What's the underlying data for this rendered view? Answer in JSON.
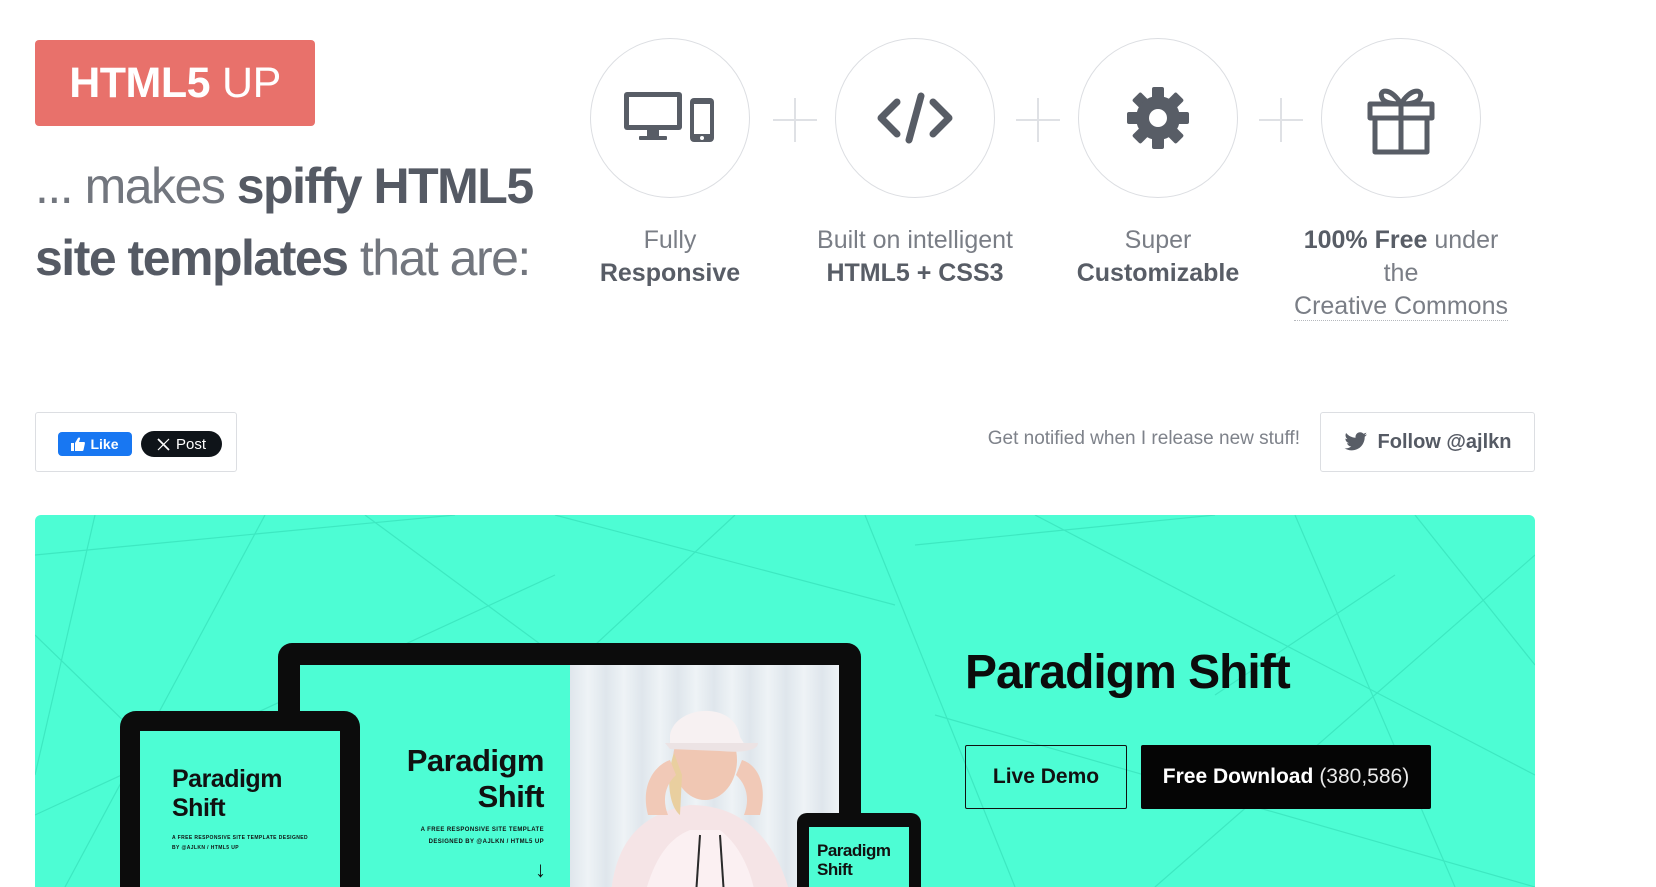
{
  "logo": {
    "strong": "HTML5",
    "light": "UP"
  },
  "tagline": {
    "part1": "... makes ",
    "part2": "spiffy HTML5",
    "part3": "site templates",
    "part4": " that are:"
  },
  "features": [
    {
      "icon": "responsive-devices-icon",
      "line1": "Fully",
      "line2": "Responsive"
    },
    {
      "icon": "code-icon",
      "line1": "Built on intelligent",
      "line2": "HTML5 + CSS3"
    },
    {
      "icon": "gear-icon",
      "line1": "Super",
      "line2": "Customizable"
    },
    {
      "icon": "gift-icon",
      "line1_strong": "100% Free",
      "line1_rest": " under the",
      "line2": "Creative Commons"
    }
  ],
  "social": {
    "like_label": "Like",
    "post_label": "Post",
    "notify_text": "Get notified when I release new stuff!",
    "follow_label": "Follow @ajlkn"
  },
  "hero": {
    "title": "Paradigm Shift",
    "demo_label": "Live Demo",
    "download_label": "Free Download",
    "download_count": "(380,586)",
    "mock_title_line1": "Paradigm",
    "mock_title_line2": "Shift",
    "mock_sub_line1": "A FREE RESPONSIVE SITE TEMPLATE",
    "mock_sub_line2": "DESIGNED BY @AJLKN / HTML5 UP",
    "mock_sub_tablet_line1": "A FREE RESPONSIVE SITE TEMPLATE DESIGNED",
    "mock_sub_tablet_line2": "BY @AJLKN / HTML5 UP",
    "arrow": "↓"
  },
  "colors": {
    "logo_bg": "#e8716b",
    "hero_bg": "#4dfdd4",
    "text_dark": "#585d66",
    "download_bg": "#050505",
    "facebook_blue": "#1877f2"
  }
}
